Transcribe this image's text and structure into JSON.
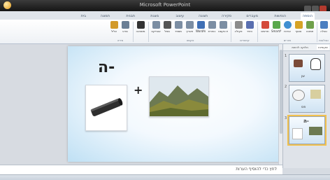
{
  "window": {
    "title": "Microsoft PowerPoint"
  },
  "tabs": [
    "הוספה",
    "הנפשות",
    "מעברים",
    "סקירה",
    "תצוגה",
    "עיצוב",
    "מצגת",
    "תבנית",
    "תמונה",
    "בית"
  ],
  "ribbon": {
    "buttons": [
      {
        "label": "טבלה",
        "icon": "table-icon",
        "color": "#4b7fc1"
      },
      {
        "label": "תמונה",
        "icon": "picture-icon",
        "color": "#6fa04a"
      },
      {
        "label": "אוסף",
        "icon": "clipart-icon",
        "color": "#d6a326"
      },
      {
        "label": "צורות",
        "icon": "shapes-icon",
        "color": "#3f8fd1"
      },
      {
        "label": "SmartArt",
        "icon": "smartart-icon",
        "color": "#59a84b"
      },
      {
        "label": "תרשים",
        "icon": "chart-icon",
        "color": "#d44a3a"
      },
      {
        "label": "היפר",
        "icon": "hyperlink-icon",
        "color": "#5a6fb0"
      },
      {
        "label": "פעולה",
        "icon": "action-icon",
        "color": "#8c8c8c"
      },
      {
        "label": "תיבת טקסט",
        "icon": "textbox-icon",
        "color": "#7c8ea3"
      },
      {
        "label": "כותרת",
        "icon": "header-icon",
        "color": "#7c8ea3"
      },
      {
        "label": "WordArt",
        "icon": "wordart-icon",
        "color": "#3f6fb5"
      },
      {
        "label": "תאריך",
        "icon": "date-icon",
        "color": "#7c8ea3"
      },
      {
        "label": "מספר",
        "icon": "slide-number-icon",
        "color": "#7c8ea3"
      },
      {
        "label": "סמל",
        "icon": "symbol-icon",
        "color": "#555555"
      },
      {
        "label": "אובייקט",
        "icon": "object-icon",
        "color": "#7c8ea3"
      },
      {
        "label": "משוואה",
        "icon": "equation-icon",
        "color": "#333333"
      },
      {
        "label": "סרט",
        "icon": "movie-icon",
        "color": "#6a7f95"
      },
      {
        "label": "צליל",
        "icon": "sound-icon",
        "color": "#d29a2a"
      }
    ],
    "groups": [
      "טבלאות",
      "איורים",
      "קישורים",
      "טקסט",
      "מדיה"
    ]
  },
  "slide": {
    "title": "ה-",
    "operator": "+"
  },
  "thumbnails": [
    {
      "number": "1",
      "caption": "שן"
    },
    {
      "number": "2",
      "caption": "פס"
    },
    {
      "number": "3",
      "caption": "ה-"
    }
  ],
  "thumb_tabs": [
    "שקופיות",
    "חלוקה לרמות"
  ],
  "notes": {
    "placeholder": "לחץ כדי להוסיף הערות"
  },
  "accent": "#f2c14e"
}
